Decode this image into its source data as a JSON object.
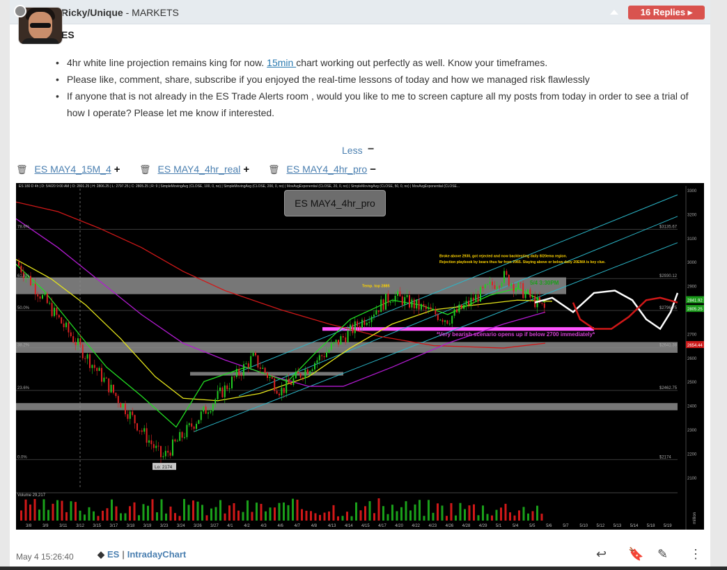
{
  "post": {
    "username": "Ricky/Unique",
    "separator": " - ",
    "room": "MARKETS",
    "replies_label": "16 Replies",
    "symbol_title": "ES"
  },
  "bullets": [
    {
      "before": "4hr white line projection remains king for now. ",
      "link": "15min ",
      "after": "chart working out perfectly as well. Know your timeframes."
    },
    {
      "before": "Please like, comment, share, subscribe if you enjoyed the real-time lessons of today and how we managed risk flawlessly",
      "link": "",
      "after": ""
    },
    {
      "before": "If anyone that is not already in the ES Trade Alerts room , would you like to me to screen capture all my posts from today in order to see a trial of how I operate? Please let me know if interested.",
      "link": "",
      "after": ""
    }
  ],
  "less_label": "Less",
  "less_symbol": "−",
  "attachments": [
    {
      "label": "ES MAY4_15M_4",
      "symbol": "+"
    },
    {
      "label": "ES MAY4_4hr_real",
      "symbol": "+"
    },
    {
      "label": "ES MAY4_4hr_pro",
      "symbol": "−"
    }
  ],
  "chart": {
    "tooltip": "ES MAY4_4hr_pro",
    "header": "ES 180 D 4h  |  D: 5/4/20 9:00 AM  |  O: 2801.25  |  H: 2806.25  |  L: 2797.25  |  C: 2805.25  |  R: 9  |  SimpleMovingAvg (CLOSE, 100, 0, no)  |  SimpleMovingAvg (CLOSE, 200, 0, no)  |  MovAvgExponential (CLOSE, 20, 0, no)  |  SimpleMovingAvg (CLOSE, 50, 0, no)  |  MovAvgExponential (CLOSE...",
    "annotation_broke": "Broke above 2930, got rejected and now backtesting daily 8/20ema region.",
    "annotation_rejection": "Rejection playbook by bears thus far from 2965. Staying above or below daily 20EMA is key clue.",
    "temp_top": "Temp. top 2885",
    "time_label": "5/4 3:30PM",
    "bearish": "*Very bearish scenario opens up if below 2700 immediately*",
    "low_label": "Lo: 2174",
    "volume_label": "Volume  29,217",
    "fib_labels": [
      "78.6%",
      "61.8%",
      "50.0%",
      "38.2%",
      "23.6%",
      "0.0%"
    ],
    "level_labels": [
      "$3135.67",
      "$2930.12",
      "$2796.75",
      "$2641.38",
      "$2462.75",
      "$2174"
    ],
    "price_ticks": [
      "3300",
      "3200",
      "3100",
      "3000",
      "2900",
      "2800",
      "2700",
      "2600",
      "2500",
      "2400",
      "2300",
      "2200",
      "2100"
    ],
    "price_boxes": [
      "2841.92",
      "2805.25",
      "2654.44"
    ],
    "x_labels": [
      "3/8",
      "3/9",
      "3/11",
      "3/12",
      "3/15",
      "3/17",
      "3/18",
      "3/19",
      "3/23",
      "3/24",
      "3/26",
      "3/27",
      "4/1",
      "4/2",
      "4/3",
      "4/6",
      "4/7",
      "4/8",
      "4/13",
      "4/14",
      "4/15",
      "4/17",
      "4/20",
      "4/22",
      "4/23",
      "4/26",
      "4/28",
      "4/29",
      "5/1",
      "5/4",
      "5/5",
      "5/6",
      "5/7",
      "5/10",
      "5/12",
      "5/13",
      "5/14",
      "5/18",
      "5/19"
    ],
    "volume_unit": "million",
    "colors": {
      "ma_green": "#22dd22",
      "ma_yellow": "#e6e61a",
      "ma_magenta": "#b21bd1",
      "ma_red": "#d01818",
      "projection_white": "#ffffff",
      "channel_cyan": "#2bb7c9",
      "zone_gray": "#8c8c8c",
      "zone_pink": "#ff55ff",
      "volume_red": "#d01818",
      "volume_green": "#1aa01a"
    }
  },
  "footer": {
    "timestamp": "May 4 15:26:40",
    "tag_symbol": "ES",
    "tag_separator": "|",
    "tag_label": "IntradayChart"
  }
}
